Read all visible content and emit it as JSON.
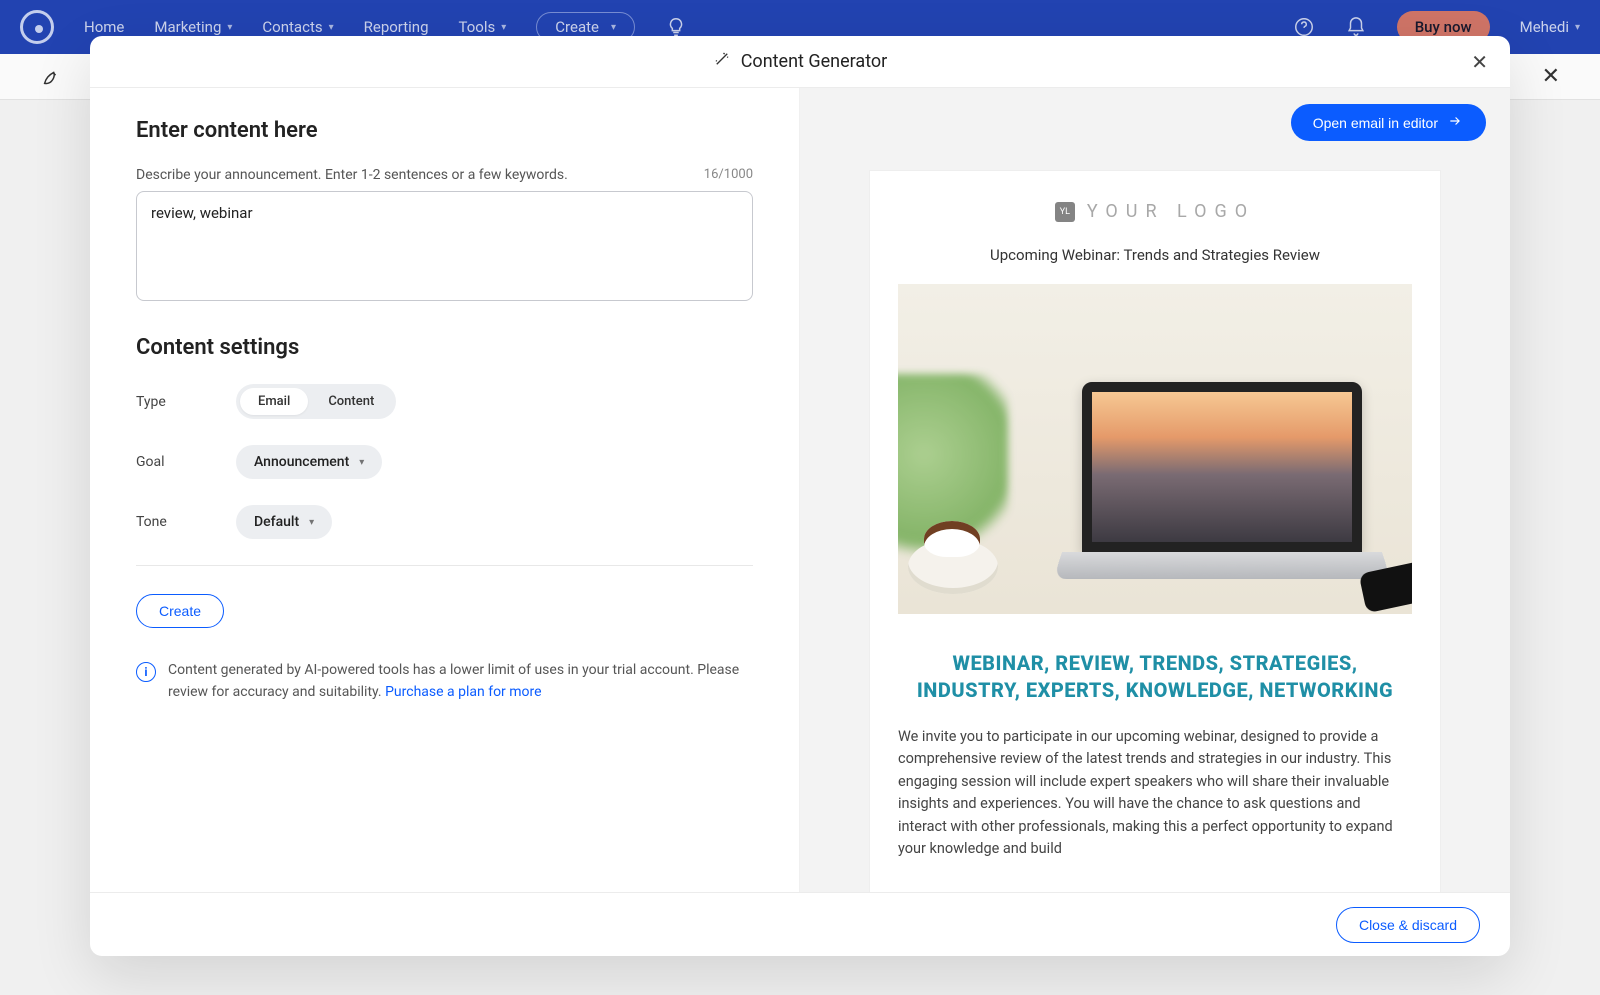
{
  "nav": {
    "home": "Home",
    "marketing": "Marketing",
    "contacts": "Contacts",
    "reporting": "Reporting",
    "tools": "Tools",
    "create": "Create",
    "buy_now": "Buy now",
    "user": "Mehedi"
  },
  "modal": {
    "title": "Content Generator",
    "open_editor": "Open email in editor",
    "close_discard": "Close & discard"
  },
  "left": {
    "enter_heading": "Enter content here",
    "describe_label": "Describe your announcement. Enter 1-2 sentences or a few keywords.",
    "counter": "16/1000",
    "input_value": "review, webinar",
    "settings_heading": "Content settings",
    "type_label": "Type",
    "type_email": "Email",
    "type_content": "Content",
    "goal_label": "Goal",
    "goal_value": "Announcement",
    "tone_label": "Tone",
    "tone_value": "Default",
    "create_btn": "Create",
    "info_text": "Content generated by AI-powered tools has a lower limit of uses in your trial account. Please review for accuracy and suitability. ",
    "info_link": "Purchase a plan for more"
  },
  "preview": {
    "logo_text": "YOUR LOGO",
    "logo_badge": "YL",
    "subject": "Upcoming Webinar: Trends and Strategies Review",
    "headline": "WEBINAR, REVIEW, TRENDS, STRATEGIES, INDUSTRY, EXPERTS, KNOWLEDGE, NETWORKING",
    "body": "We invite you to participate in our upcoming webinar, designed to provide a comprehensive review of the latest trends and strategies in our industry. This engaging session will include expert speakers who will share their invaluable insights and experiences. You will have the chance to ask questions and interact with other professionals, making this a perfect opportunity to expand your knowledge and build"
  }
}
